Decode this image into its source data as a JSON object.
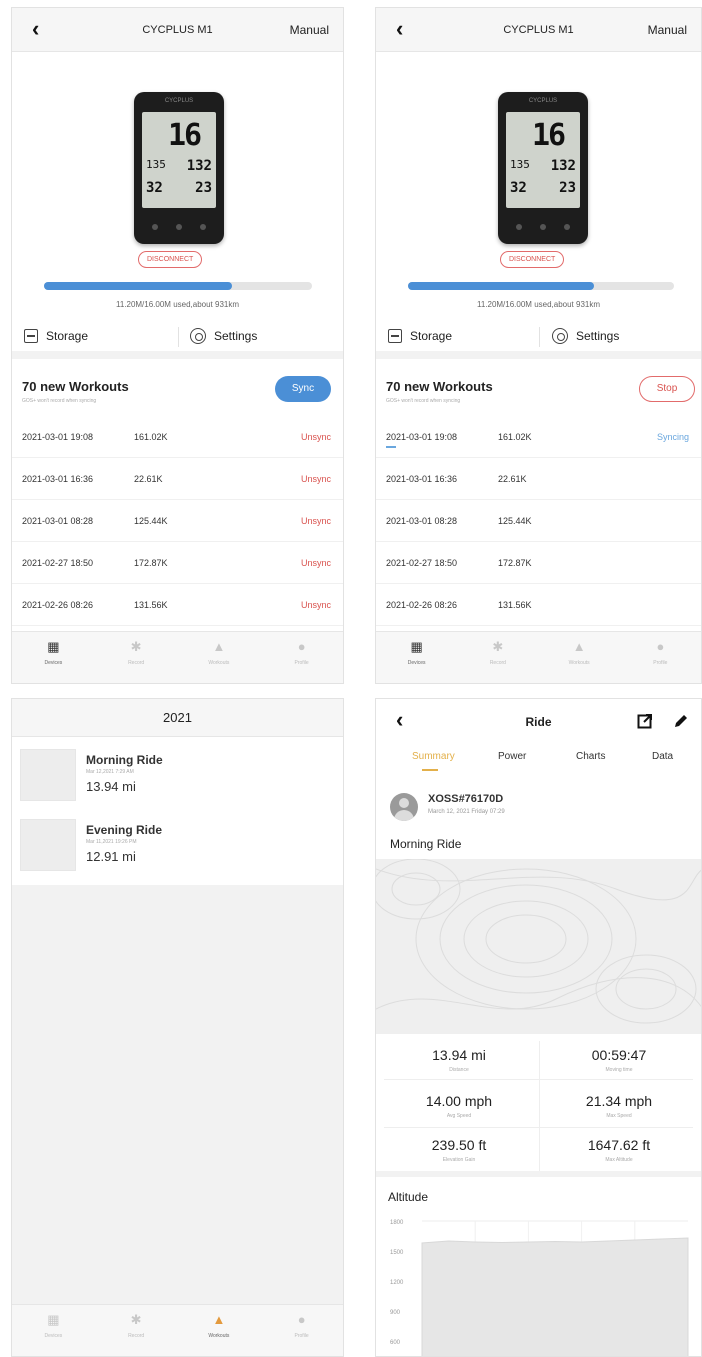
{
  "colors": {
    "accent": "#4b8fd6",
    "danger": "#d9534f",
    "syncing": "#6aa7de",
    "highlight": "#e3b04a"
  },
  "device_panel": {
    "header": {
      "back_icon": "chevron-left-icon",
      "title": "CYCPLUS M1",
      "right": "Manual"
    },
    "device_screen": {
      "speed": "16",
      "decimal": "3",
      "v1": "135",
      "v2": "132",
      "v3": "32",
      "v4": "23"
    },
    "disconnect_label": "DISCONNECT",
    "storage": {
      "used_fraction": 0.7,
      "text": "11.20M/16.00M used,about 931km"
    },
    "storage_label": "Storage",
    "settings_label": "Settings",
    "workouts_title": "70 new Workouts",
    "workouts_subtitle": "GOS+ won't record when syncing",
    "sync_label": "Sync",
    "stop_label": "Stop",
    "rows": [
      {
        "date": "2021-03-01 19:08",
        "size": "161.02K",
        "status": "Unsync"
      },
      {
        "date": "2021-03-01 16:36",
        "size": "22.61K",
        "status": "Unsync"
      },
      {
        "date": "2021-03-01 08:28",
        "size": "125.44K",
        "status": "Unsync"
      },
      {
        "date": "2021-02-27 18:50",
        "size": "172.87K",
        "status": "Unsync"
      },
      {
        "date": "2021-02-26 08:26",
        "size": "131.56K",
        "status": "Unsync"
      }
    ],
    "syncing_label": "Syncing",
    "tabs": [
      {
        "label": "Devices",
        "icon": "devices-icon"
      },
      {
        "label": "Record",
        "icon": "record-icon"
      },
      {
        "label": "Workouts",
        "icon": "workouts-icon"
      },
      {
        "label": "Profile",
        "icon": "profile-icon"
      }
    ]
  },
  "workouts_panel": {
    "year": "2021",
    "items": [
      {
        "name": "Morning Ride",
        "date": "Mar 12,2021 7:29 AM",
        "distance": "13.94 mi"
      },
      {
        "name": "Evening Ride",
        "date": "Mar 11,2021 19:26 PM",
        "distance": "12.91 mi"
      }
    ]
  },
  "ride_panel": {
    "title": "Ride",
    "tabs": [
      "Summary",
      "Power",
      "Charts",
      "Data"
    ],
    "user": {
      "name": "XOSS#76170D",
      "date": "March 12, 2021 Friday 07:29"
    },
    "ride_name": "Morning Ride",
    "stats": [
      {
        "value": "13.94 mi",
        "label": "Distance"
      },
      {
        "value": "00:59:47",
        "label": "Moving time"
      },
      {
        "value": "14.00 mph",
        "label": "Avg Speed"
      },
      {
        "value": "21.34 mph",
        "label": "Max Speed"
      },
      {
        "value": "239.50 ft",
        "label": "Elevation Gain"
      },
      {
        "value": "1647.62 ft",
        "label": "Max Altitude"
      }
    ],
    "altitude_title": "Altitude"
  },
  "chart_data": {
    "type": "area",
    "title": "Altitude",
    "yticks": [
      1800,
      1500,
      1200,
      900,
      600
    ],
    "ylim": [
      0,
      1800
    ],
    "x": [
      0,
      1,
      2,
      3,
      4,
      5,
      6,
      7,
      8,
      9,
      10
    ],
    "values": [
      1580,
      1600,
      1590,
      1585,
      1590,
      1595,
      1590,
      1600,
      1610,
      1620,
      1630
    ]
  }
}
